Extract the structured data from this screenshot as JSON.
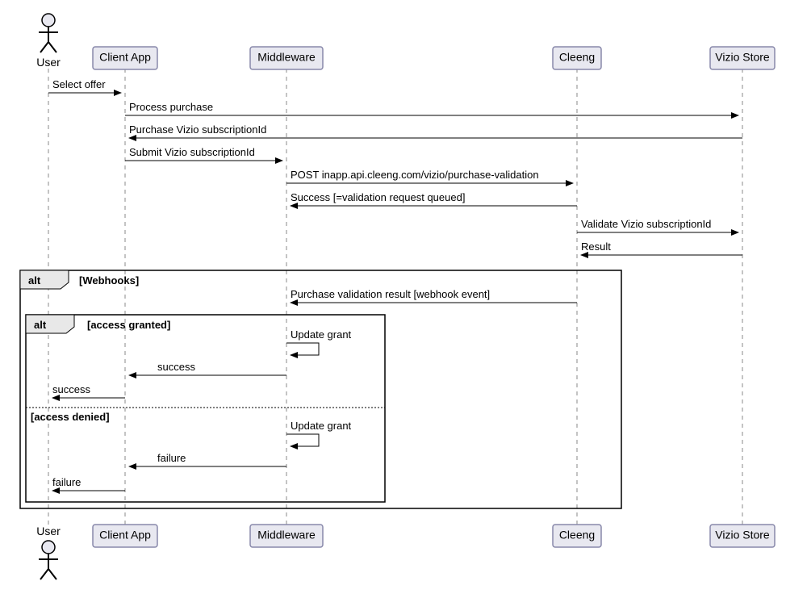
{
  "participants": {
    "user": "User",
    "clientApp": "Client App",
    "middleware": "Middleware",
    "cleeng": "Cleeng",
    "vizioStore": "Vizio Store"
  },
  "messages": {
    "m1": "Select offer",
    "m2": "Process purchase",
    "m3": "Purchase Vizio subscriptionId",
    "m4": "Submit Vizio subscriptionId",
    "m5": "POST inapp.api.cleeng.com/vizio/purchase-validation",
    "m6": "Success [=validation request queued]",
    "m7": "Validate Vizio subscriptionId",
    "m8": "Result",
    "m9": "Purchase validation result [webhook event]",
    "m10": "Update grant",
    "m11": "success",
    "m12": "success",
    "m13": "Update grant",
    "m14": "failure",
    "m15": "failure"
  },
  "altLabels": {
    "outer": "alt",
    "outerCond": "[Webhooks]",
    "inner": "alt",
    "innerCond1": "[access granted]",
    "innerCond2": "[access denied]"
  },
  "chart_data": {
    "type": "sequence-diagram",
    "participants": [
      "User",
      "Client App",
      "Middleware",
      "Cleeng",
      "Vizio Store"
    ],
    "interactions": [
      {
        "from": "User",
        "to": "Client App",
        "label": "Select offer"
      },
      {
        "from": "Client App",
        "to": "Vizio Store",
        "label": "Process purchase"
      },
      {
        "from": "Vizio Store",
        "to": "Client App",
        "label": "Purchase Vizio subscriptionId"
      },
      {
        "from": "Client App",
        "to": "Middleware",
        "label": "Submit Vizio subscriptionId"
      },
      {
        "from": "Middleware",
        "to": "Cleeng",
        "label": "POST inapp.api.cleeng.com/vizio/purchase-validation"
      },
      {
        "from": "Cleeng",
        "to": "Middleware",
        "label": "Success [=validation request queued]"
      },
      {
        "from": "Cleeng",
        "to": "Vizio Store",
        "label": "Validate Vizio subscriptionId"
      },
      {
        "from": "Vizio Store",
        "to": "Cleeng",
        "label": "Result"
      },
      {
        "fragment": "alt",
        "condition": "[Webhooks]",
        "contents": [
          {
            "from": "Cleeng",
            "to": "Middleware",
            "label": "Purchase validation result [webhook event]"
          },
          {
            "fragment": "alt",
            "condition": "[access granted]",
            "contents": [
              {
                "from": "Middleware",
                "to": "Middleware",
                "label": "Update grant"
              },
              {
                "from": "Middleware",
                "to": "Client App",
                "label": "success"
              },
              {
                "from": "Client App",
                "to": "User",
                "label": "success"
              }
            ],
            "else": {
              "condition": "[access denied]",
              "contents": [
                {
                  "from": "Middleware",
                  "to": "Middleware",
                  "label": "Update grant"
                },
                {
                  "from": "Middleware",
                  "to": "Client App",
                  "label": "failure"
                },
                {
                  "from": "Client App",
                  "to": "User",
                  "label": "failure"
                }
              ]
            }
          }
        ]
      }
    ]
  }
}
